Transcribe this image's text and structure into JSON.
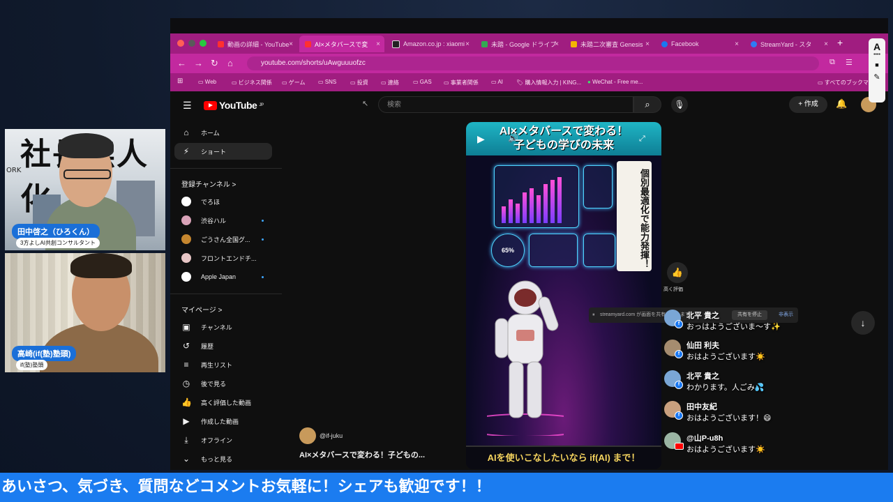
{
  "webcams": [
    {
      "bg_text": "社長無人化",
      "bg_sub": "ORK",
      "name": "田中啓之（ひろくん）",
      "title": "3方よしAI共創コンサルタント"
    },
    {
      "name": "高崎(if(塾)塾頭)",
      "title": "if(塾)塾頭"
    }
  ],
  "tabs": [
    {
      "label": "動画の詳細 - YouTube",
      "color": "#ff3030"
    },
    {
      "label": "AI×メタバースで変",
      "color": "#ff3030",
      "active": true
    },
    {
      "label": "Amazon.co.jp : xiaomi",
      "color": "#222222"
    },
    {
      "label": "未踏 - Google ドライブ",
      "color": "#34a853"
    },
    {
      "label": "未踏二次審査 Genesis",
      "color": "#f4b400"
    },
    {
      "label": "Facebook",
      "color": "#1877f2"
    },
    {
      "label": "StreamYard - スタ",
      "color": "#2f7bf5"
    }
  ],
  "tab_close": "×",
  "new_tab": "+",
  "nav": {
    "back": "←",
    "forward": "→",
    "reload": "↻",
    "home": "⌂",
    "url": "youtube.com/shorts/uAwguuuofzc"
  },
  "bookmarks": [
    "Web",
    "ビジネス関係",
    "ゲーム",
    "SNS",
    "投資",
    "連絡",
    "GAS",
    "事業者関係",
    "AI",
    "購入情報入力 | KING...",
    "WeChat - Free me...",
    "すべてのブックマーク"
  ],
  "youtube": {
    "logo": "YouTube",
    "logo_sup": "JP",
    "search_placeholder": "検索",
    "create": "+ 作成",
    "sidebar_main": [
      {
        "icon": "⌂",
        "label": "ホーム"
      },
      {
        "icon": "⚡",
        "label": "ショート",
        "active": true
      }
    ],
    "subs_heading": "登録チャンネル >",
    "subscriptions": [
      {
        "label": "でろほ",
        "color": "#ffffff",
        "dot": false
      },
      {
        "label": "渋谷ハル",
        "color": "#d9a3b8",
        "dot": true
      },
      {
        "label": "ごうさん全国グ...",
        "color": "#c5862f",
        "dot": true
      },
      {
        "label": "フロントエンドチ...",
        "color": "#e7c6c6",
        "dot": false
      },
      {
        "label": "Apple Japan",
        "color": "#ffffff",
        "dot": true
      }
    ],
    "mypage_heading": "マイページ >",
    "mypage": [
      {
        "icon": "▣",
        "label": "チャンネル"
      },
      {
        "icon": "↺",
        "label": "履歴"
      },
      {
        "icon": "≡",
        "label": "再生リスト"
      },
      {
        "icon": "◷",
        "label": "後で見る"
      },
      {
        "icon": "👍",
        "label": "高く評価した動画"
      },
      {
        "icon": "▶",
        "label": "作成した動画"
      },
      {
        "icon": "⤓",
        "label": "オフライン"
      },
      {
        "icon": "⌄",
        "label": "もっと見る"
      }
    ],
    "short": {
      "title_line1": "AI×メタバースで変わる！",
      "title_line2": "子どもの学びの未来",
      "banner": "個別最適化で能力発揮！",
      "chart_label": "65%",
      "cta": "AIを使いこなしたいなら if(AI) まで！",
      "handle": "@if-juku",
      "caption": "AI×メタバースで変わる！子どもの..."
    },
    "like_label": "高く評価",
    "share_bar": {
      "text": "streamyard.com が画面を共有しています。",
      "stop": "共有を停止",
      "hide": "非表示"
    }
  },
  "comments": [
    {
      "name": "北平 貴之",
      "text": "おっはようございま〜す✨",
      "color": "#7aa6d6",
      "platform": "fb"
    },
    {
      "name": "仙田 利夫",
      "text": "おはようございます☀️",
      "color": "#a58c6f",
      "platform": "fb"
    },
    {
      "name": "北平 貴之",
      "text": "わかります。人ごみ💦",
      "color": "#7aa6d6",
      "platform": "fb"
    },
    {
      "name": "田中友紀",
      "text": "おはようございます！😄",
      "color": "#c9a07e",
      "platform": "fb"
    },
    {
      "name": "@山P-u8h",
      "text": "おはようございます☀️",
      "color": "#9bb5a4",
      "platform": "yt"
    }
  ],
  "ticker": "あいさつ、気づき、質問などコメントお気軽に！シェアも歓迎です！！"
}
